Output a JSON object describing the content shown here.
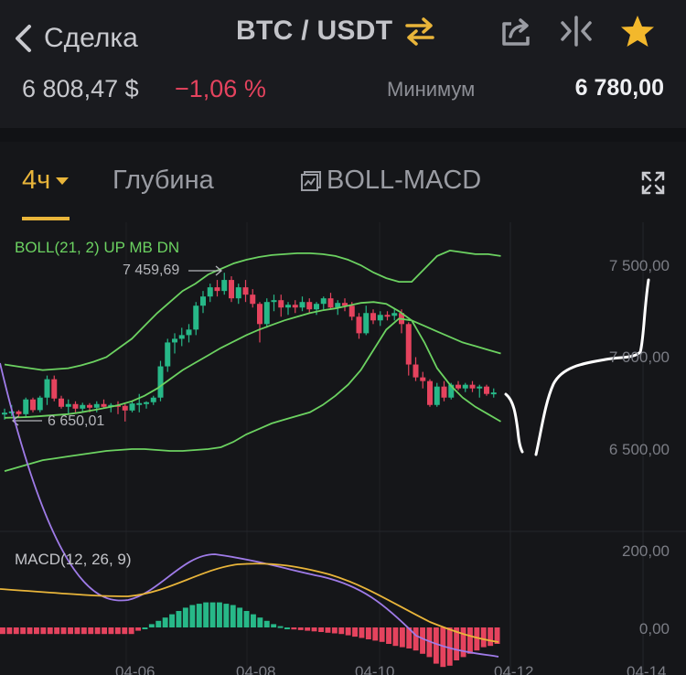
{
  "nav": {
    "back_label": "Сделка",
    "pair_label": "BTC / USDT",
    "icons": [
      "chevron-left-icon",
      "swap-icon",
      "share-icon",
      "compare-icon",
      "star-icon"
    ],
    "accent": "#e9b53a"
  },
  "ticker": {
    "price": "6 808,47 $",
    "change": "−1,06 %",
    "min_label": "Минимум",
    "min_value": "6 780,00",
    "change_color": "#e5435e"
  },
  "tabs": {
    "interval": "4ч",
    "depth": "Глубина",
    "indicator": "BOLL-MACD"
  },
  "chart_data": {
    "type": "candlestick",
    "indicators": {
      "boll": "BOLL(21, 2) UP MB DN",
      "macd": "MACD(12, 26, 9)"
    },
    "y_ticks": [
      "7 500,00",
      "7 000,00",
      "6 500,00"
    ],
    "macd_ticks": [
      "200,00",
      "0,00"
    ],
    "x_ticks": [
      "04-06",
      "04-08",
      "04-10",
      "04-12",
      "04-14"
    ],
    "annotations": {
      "high": "7 459,69",
      "low": "6 650,01"
    },
    "up_color": "#27b888",
    "down_color": "#e5435e",
    "candles": [
      [
        6692,
        6720,
        6660,
        6698
      ],
      [
        6698,
        6740,
        6680,
        6705
      ],
      [
        6705,
        6712,
        6670,
        6690
      ],
      [
        6690,
        6780,
        6670,
        6770
      ],
      [
        6770,
        6780,
        6700,
        6712
      ],
      [
        6712,
        6790,
        6700,
        6780
      ],
      [
        6780,
        6900,
        6740,
        6880
      ],
      [
        6880,
        6900,
        6760,
        6775
      ],
      [
        6775,
        6790,
        6720,
        6730
      ],
      [
        6730,
        6770,
        6690,
        6745
      ],
      [
        6745,
        6760,
        6700,
        6720
      ],
      [
        6720,
        6752,
        6705,
        6740
      ],
      [
        6740,
        6750,
        6700,
        6725
      ],
      [
        6725,
        6760,
        6700,
        6745
      ],
      [
        6745,
        6770,
        6720,
        6730
      ],
      [
        6730,
        6750,
        6700,
        6740
      ],
      [
        6740,
        6760,
        6690,
        6735
      ],
      [
        6735,
        6745,
        6650,
        6710
      ],
      [
        6710,
        6760,
        6700,
        6748
      ],
      [
        6748,
        6800,
        6700,
        6750
      ],
      [
        6750,
        6760,
        6720,
        6755
      ],
      [
        6755,
        6790,
        6740,
        6780
      ],
      [
        6780,
        6980,
        6760,
        6950
      ],
      [
        6950,
        7100,
        6920,
        7080
      ],
      [
        7080,
        7130,
        7020,
        7100
      ],
      [
        7100,
        7160,
        7060,
        7120
      ],
      [
        7120,
        7180,
        7080,
        7150
      ],
      [
        7150,
        7300,
        7120,
        7280
      ],
      [
        7280,
        7360,
        7240,
        7330
      ],
      [
        7330,
        7400,
        7300,
        7380
      ],
      [
        7380,
        7420,
        7330,
        7360
      ],
      [
        7360,
        7459,
        7340,
        7420
      ],
      [
        7420,
        7440,
        7300,
        7320
      ],
      [
        7320,
        7400,
        7290,
        7380
      ],
      [
        7380,
        7420,
        7300,
        7340
      ],
      [
        7340,
        7370,
        7270,
        7290
      ],
      [
        7290,
        7300,
        7080,
        7180
      ],
      [
        7180,
        7320,
        7160,
        7300
      ],
      [
        7300,
        7340,
        7250,
        7310
      ],
      [
        7310,
        7340,
        7220,
        7270
      ],
      [
        7270,
        7300,
        7230,
        7285
      ],
      [
        7285,
        7310,
        7240,
        7270
      ],
      [
        7270,
        7330,
        7250,
        7300
      ],
      [
        7300,
        7320,
        7240,
        7260
      ],
      [
        7260,
        7300,
        7230,
        7290
      ],
      [
        7290,
        7330,
        7260,
        7320
      ],
      [
        7320,
        7350,
        7260,
        7270
      ],
      [
        7270,
        7310,
        7230,
        7295
      ],
      [
        7295,
        7320,
        7250,
        7280
      ],
      [
        7280,
        7300,
        7200,
        7220
      ],
      [
        7220,
        7240,
        7100,
        7130
      ],
      [
        7130,
        7280,
        7120,
        7240
      ],
      [
        7240,
        7260,
        7180,
        7200
      ],
      [
        7200,
        7250,
        7170,
        7230
      ],
      [
        7230,
        7250,
        7200,
        7225
      ],
      [
        7225,
        7260,
        7200,
        7240
      ],
      [
        7240,
        7260,
        7130,
        7180
      ],
      [
        7180,
        7190,
        6900,
        6960
      ],
      [
        6960,
        7000,
        6870,
        6890
      ],
      [
        6890,
        6920,
        6830,
        6870
      ],
      [
        6870,
        6880,
        6730,
        6740
      ],
      [
        6740,
        6860,
        6730,
        6840
      ],
      [
        6840,
        6870,
        6760,
        6780
      ],
      [
        6780,
        6860,
        6770,
        6850
      ],
      [
        6850,
        6870,
        6820,
        6830
      ],
      [
        6830,
        6860,
        6810,
        6850
      ],
      [
        6850,
        6870,
        6810,
        6830
      ],
      [
        6830,
        6850,
        6780,
        6840
      ],
      [
        6840,
        6850,
        6790,
        6800
      ],
      [
        6800,
        6830,
        6780,
        6808
      ]
    ],
    "boll_up": [
      6960,
      6950,
      6940,
      6930,
      6935,
      6940,
      6955,
      6975,
      7000,
      7050,
      7100,
      7170,
      7240,
      7300,
      7360,
      7400,
      7450,
      7480,
      7510,
      7530,
      7545,
      7555,
      7560,
      7565,
      7565,
      7560,
      7550,
      7530,
      7500,
      7460,
      7430,
      7410,
      7410,
      7480,
      7550,
      7580,
      7570,
      7560,
      7560,
      7550
    ],
    "boll_mb": [
      6670,
      6672,
      6675,
      6680,
      6685,
      6690,
      6700,
      6712,
      6725,
      6740,
      6760,
      6790,
      6830,
      6880,
      6930,
      6970,
      7010,
      7050,
      7085,
      7120,
      7150,
      7175,
      7200,
      7220,
      7240,
      7255,
      7265,
      7280,
      7295,
      7300,
      7290,
      7250,
      7200,
      7170,
      7140,
      7110,
      7080,
      7060,
      7040,
      7020
    ],
    "boll_dn": [
      6380,
      6400,
      6420,
      6440,
      6450,
      6460,
      6470,
      6480,
      6490,
      6495,
      6500,
      6500,
      6495,
      6490,
      6490,
      6495,
      6500,
      6510,
      6540,
      6580,
      6610,
      6640,
      6660,
      6680,
      6700,
      6740,
      6790,
      6850,
      6930,
      7040,
      7150,
      7210,
      7200,
      7080,
      6940,
      6850,
      6780,
      6730,
      6690,
      6650
    ],
    "macd_hist": [
      -10,
      -10,
      -10,
      -10,
      -10,
      -10,
      -10,
      -10,
      -10,
      -10,
      -10,
      -10,
      -10,
      -10,
      -10,
      -10,
      -10,
      -10,
      -10,
      -10,
      -5,
      0,
      5,
      10,
      15,
      20,
      25,
      30,
      34,
      36,
      38,
      38,
      38,
      36,
      34,
      30,
      25,
      20,
      15,
      10,
      5,
      2,
      0,
      -3,
      -4,
      -5,
      -6,
      -7,
      -8,
      -9,
      -10,
      -12,
      -14,
      -16,
      -18,
      -20,
      -22,
      -25,
      -28,
      -30,
      -32,
      -35,
      -40,
      -45,
      -55,
      -60,
      -58,
      -50,
      -45,
      -40,
      -35,
      -30,
      -28,
      -25
    ]
  },
  "colors": {
    "boll_lines": "#6cd261",
    "macd_line": "#9f7be8",
    "signal_line": "#e9b53a",
    "annotation_white": "#ffffff"
  }
}
